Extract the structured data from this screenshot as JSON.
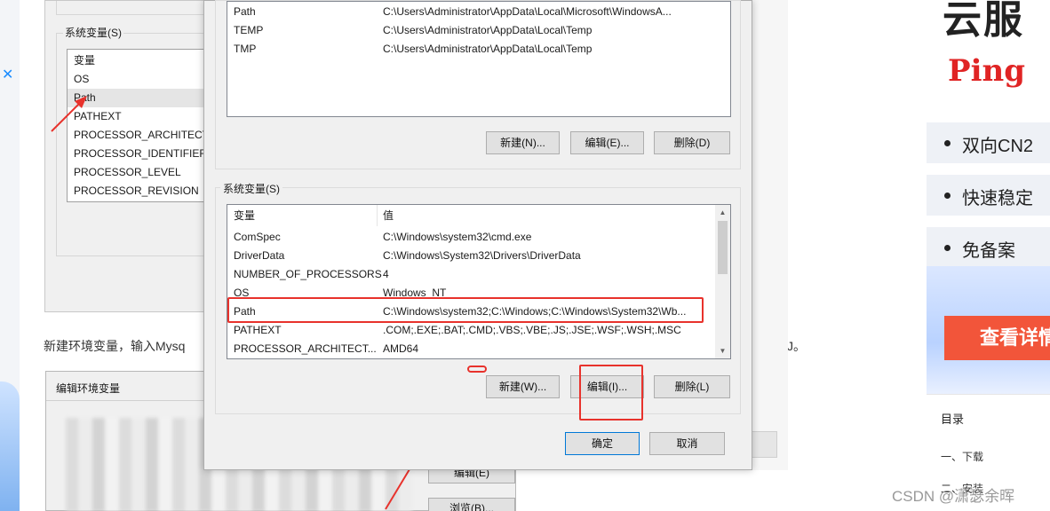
{
  "background_dialog": {
    "group_label": "系统变量(S)",
    "list_items": [
      "变量",
      "OS",
      "Path",
      "PATHEXT",
      "PROCESSOR_ARCHITECT...",
      "PROCESSOR_IDENTIFIER",
      "PROCESSOR_LEVEL",
      "PROCESSOR_REVISION"
    ],
    "selected_index": 2
  },
  "article": {
    "text": "新建环境变量，输入Mysq",
    "text_tail": "J。"
  },
  "edit_dialog": {
    "title": "编辑环境变量",
    "buttons": [
      "编辑(E)",
      "浏览(B)..."
    ]
  },
  "main_dialog": {
    "user_vars": {
      "rows": [
        {
          "name": "Path",
          "value": "C:\\Users\\Administrator\\AppData\\Local\\Microsoft\\WindowsA..."
        },
        {
          "name": "TEMP",
          "value": "C:\\Users\\Administrator\\AppData\\Local\\Temp"
        },
        {
          "name": "TMP",
          "value": "C:\\Users\\Administrator\\AppData\\Local\\Temp"
        }
      ],
      "buttons": {
        "new": "新建(N)...",
        "edit": "编辑(E)...",
        "delete": "删除(D)"
      }
    },
    "system_vars": {
      "group_label": "系统变量(S)",
      "header": {
        "name": "变量",
        "value": "值"
      },
      "rows": [
        {
          "name": "ComSpec",
          "value": "C:\\Windows\\system32\\cmd.exe"
        },
        {
          "name": "DriverData",
          "value": "C:\\Windows\\System32\\Drivers\\DriverData"
        },
        {
          "name": "NUMBER_OF_PROCESSORS",
          "value": "4"
        },
        {
          "name": "OS",
          "value": "Windows_NT"
        },
        {
          "name": "Path",
          "value": "C:\\Windows\\system32;C:\\Windows;C:\\Windows\\System32\\Wb..."
        },
        {
          "name": "PATHEXT",
          "value": ".COM;.EXE;.BAT;.CMD;.VBS;.VBE;.JS;.JSE;.WSF;.WSH;.MSC"
        },
        {
          "name": "PROCESSOR_ARCHITECT...",
          "value": "AMD64"
        }
      ],
      "highlighted_index": 4,
      "buttons": {
        "new": "新建(W)...",
        "edit": "编辑(I)...",
        "delete": "删除(L)"
      }
    },
    "footer_buttons": {
      "ok": "确定",
      "cancel": "取消"
    }
  },
  "ad": {
    "title": "云服",
    "ping": "Ping",
    "bullets": [
      "双向CN2",
      "快速稳定",
      "免备案"
    ],
    "cta": "查看详情"
  },
  "toc": {
    "title": "目录",
    "items": [
      "一、下载",
      "二、安装"
    ]
  },
  "watermark": "CSDN @潇瑟余晖",
  "colors": {
    "highlight_red": "#e8322c",
    "dialog_bg": "#f0f0f0",
    "accent_blue": "#0078d7",
    "ping_red": "#e02424",
    "cta_orange": "#f2553a"
  }
}
